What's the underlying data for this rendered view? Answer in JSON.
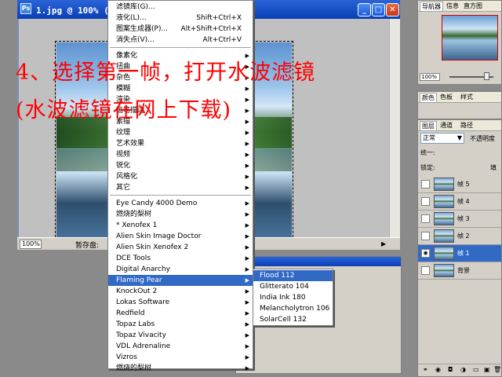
{
  "document": {
    "title": "1.jpg @ 100% (帧",
    "zoom": "100%",
    "scratch_label": "暂存盘:"
  },
  "main_menu": {
    "top_items": [
      {
        "label": "滤镜库(G)...",
        "shortcut": ""
      },
      {
        "label": "液化(L)...",
        "shortcut": "Shift+Ctrl+X"
      },
      {
        "label": "图案生成器(P)...",
        "shortcut": "Alt+Shift+Ctrl+X"
      },
      {
        "label": "消失点(V)...",
        "shortcut": "Alt+Ctrl+V"
      }
    ],
    "builtin_items": [
      "像素化",
      "扭曲",
      "杂色",
      "模糊",
      "渲染",
      "画笔描边",
      "素描",
      "纹理",
      "艺术效果",
      "视频",
      "锐化",
      "风格化",
      "其它"
    ],
    "plugin_items": [
      "Eye Candy 4000 Demo",
      "燃烧的梨树",
      "* Xenofex 1",
      "Alien Skin Image Doctor",
      "Alien Skin Xenofex 2",
      "DCE Tools",
      "Digital Anarchy",
      "Flaming Pear",
      "KnockOut 2",
      "Lokas Software",
      "Redfield",
      "Topaz Labs",
      "Topaz Vivacity",
      "VDL Adrenaline",
      "Vizros",
      "燃烧的梨树"
    ],
    "highlighted": "Flaming Pear"
  },
  "submenu": {
    "items": [
      "Flood 112",
      "Glitterato 104",
      "India Ink 180",
      "Melancholytron 106",
      "SolarCell 132"
    ],
    "highlighted": "Flood 112"
  },
  "annotation": {
    "line1": "4、选择第一帧，打开水波滤镜",
    "line2": "(水波滤镜在网上下载)"
  },
  "navigator": {
    "tabs": [
      "导航器",
      "信息",
      "直方图"
    ],
    "zoom": "100%"
  },
  "color_panel": {
    "tabs": [
      "颜色",
      "色板",
      "样式"
    ]
  },
  "layers_panel": {
    "tabs": [
      "图层",
      "通道",
      "路径"
    ],
    "blend_mode": "正常",
    "opacity_label": "不透明度",
    "unify_label": "统一:",
    "lock_label": "锁定:",
    "fill_label": "填",
    "layers": [
      {
        "name": "帧 5",
        "visible": false,
        "selected": false
      },
      {
        "name": "帧 4",
        "visible": false,
        "selected": false
      },
      {
        "name": "帧 3",
        "visible": false,
        "selected": false
      },
      {
        "name": "帧 2",
        "visible": false,
        "selected": false
      },
      {
        "name": "帧 1",
        "visible": true,
        "selected": true
      },
      {
        "name": "背景",
        "visible": false,
        "selected": false
      }
    ]
  },
  "colors": {
    "accent": "#316ac5",
    "annotation": "#ff0000"
  }
}
